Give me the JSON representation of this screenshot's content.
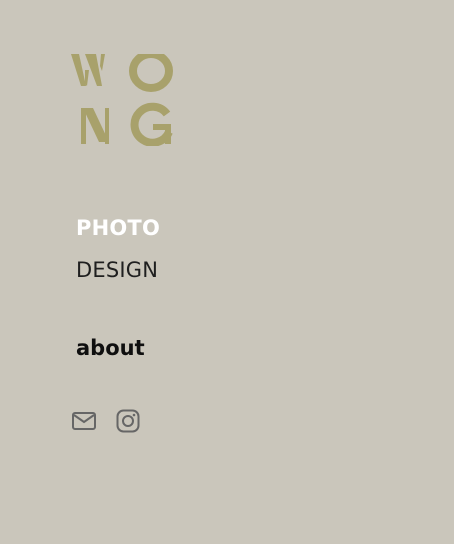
{
  "brand": {
    "logo_text": "WONG",
    "logo_color": "#a8a16b"
  },
  "nav": {
    "items": [
      {
        "label": "PHOTO",
        "active": true
      },
      {
        "label": "DESIGN",
        "active": false
      }
    ]
  },
  "about": {
    "label": "about"
  },
  "social": {
    "icons": [
      "mail-icon",
      "instagram-icon"
    ],
    "icon_color": "#666666"
  },
  "colors": {
    "background": "#cac6bb",
    "nav_active": "#ffffff",
    "nav_inactive": "#1f1f1f",
    "about": "#0f0f0f"
  }
}
